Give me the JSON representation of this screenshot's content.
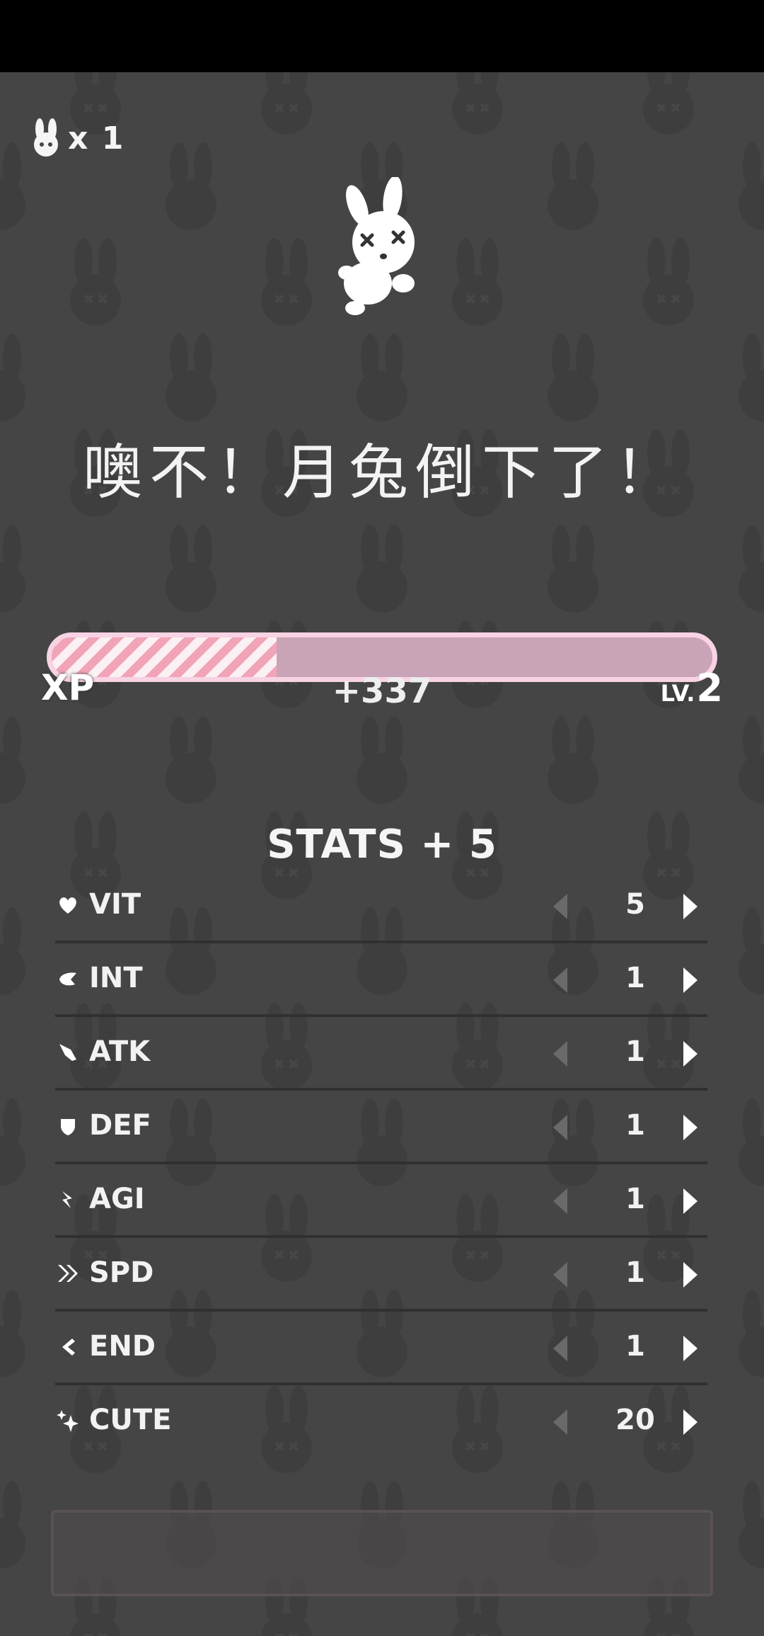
{
  "lives": {
    "icon": "bunny-head-icon",
    "text": "x 1"
  },
  "title": "噢不！月兔倒下了！",
  "xp": {
    "label": "XP",
    "gain": "+337",
    "level_prefix": "LV.",
    "level": "2",
    "progress": 0.34
  },
  "stats": {
    "title": "STATS + 5",
    "items": [
      {
        "name": "VIT",
        "value": "5",
        "icon": "heart-icon"
      },
      {
        "name": "INT",
        "value": "1",
        "icon": "brain-icon"
      },
      {
        "name": "ATK",
        "value": "1",
        "icon": "sword-icon"
      },
      {
        "name": "DEF",
        "value": "1",
        "icon": "shield-icon"
      },
      {
        "name": "AGI",
        "value": "1",
        "icon": "agility-arrow-icon"
      },
      {
        "name": "SPD",
        "value": "1",
        "icon": "double-chevron-icon"
      },
      {
        "name": "END",
        "value": "1",
        "icon": "endurance-icon"
      },
      {
        "name": "CUTE",
        "value": "20",
        "icon": "sparkle-icon"
      }
    ]
  },
  "colors": {
    "background": "#454545",
    "xp_bar_border": "#f7d3e4",
    "xp_bar_track": "#c9a4b7",
    "xp_fill_stripe": "#f1a4b7"
  }
}
